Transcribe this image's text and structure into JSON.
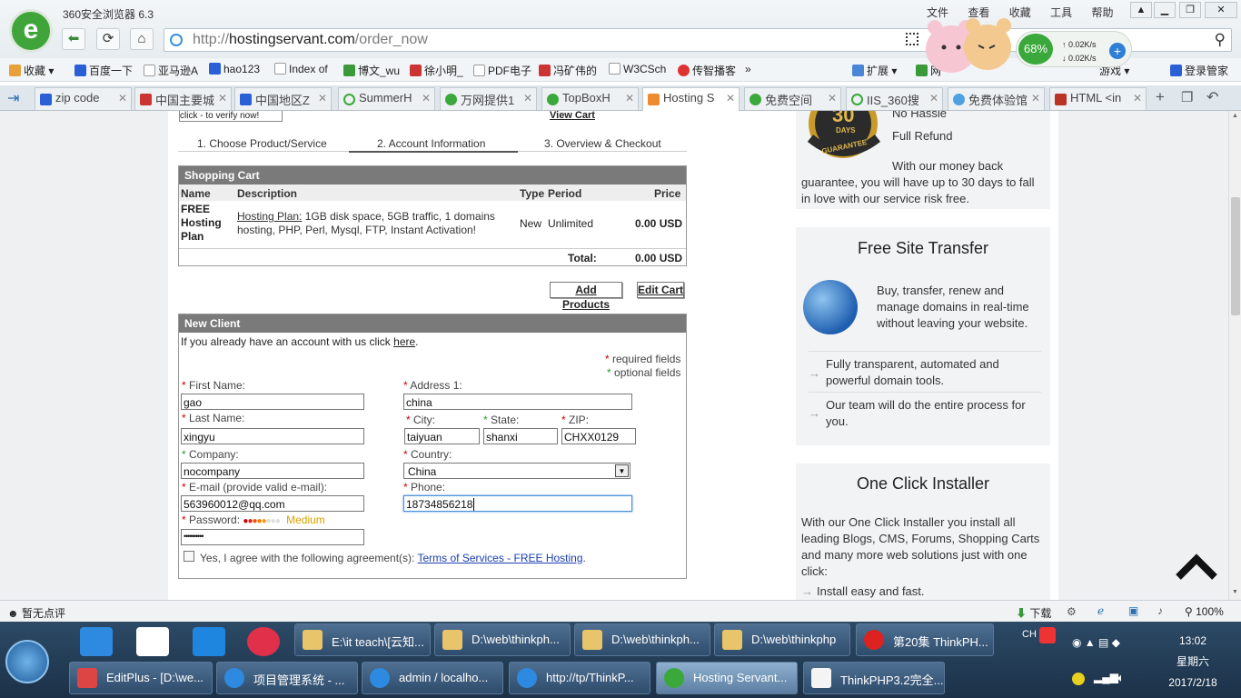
{
  "browser": {
    "app_title": "360安全浏览器 6.3",
    "url_prefix": "http://",
    "url_domain": "hostingservant.com",
    "url_path": "/order_now",
    "menu": [
      "文件",
      "查看",
      "收藏",
      "工具",
      "帮助"
    ],
    "speed_percent": "68%",
    "speed_up": "0.02K/s",
    "speed_down": "0.02K/s"
  },
  "bookmarks": [
    "收藏",
    "百度一下",
    "亚马逊A",
    "hao123",
    "Index of",
    "博文_wu",
    "徐小明_",
    "PDF电子",
    "冯矿伟的",
    "W3CSch",
    "传智播客",
    "扩展",
    "网",
    "登录管家"
  ],
  "bookmarks_extra": [
    "游戏"
  ],
  "tabs": [
    "zip code",
    "中国主要城",
    "中国地区Z",
    "SummerH",
    "万网提供1",
    "TopBoxH",
    "Hosting S",
    "免费空间",
    "IIS_360搜",
    "免费体验馆",
    "HTML <in"
  ],
  "order": {
    "top_button": "click - to verify now!",
    "top_link": "View Cart",
    "steps": [
      "1. Choose Product/Service",
      "2. Account Information",
      "3. Overview & Checkout"
    ],
    "cart": {
      "title": "Shopping Cart",
      "columns": [
        "Name",
        "Description",
        "Type",
        "Period",
        "Price"
      ],
      "item_name": "FREE Hosting Plan",
      "item_desc_link": "Hosting Plan:",
      "item_desc": "1GB disk space, 5GB traffic, 1 domains hosting, PHP, Perl, Mysql, FTP, Instant Activation!",
      "item_type": "New",
      "item_period": "Unlimited",
      "item_price": "0.00 USD",
      "total_label": "Total:",
      "total_value": "0.00 USD"
    },
    "buttons": {
      "add_products": "Add Products",
      "edit_cart": "Edit Cart"
    },
    "client": {
      "title": "New Client",
      "existing_text": "If you already have an account with us click",
      "existing_link": "here",
      "required_note": "required fields",
      "optional_note": "optional fields",
      "first_name_label": "First Name:",
      "first_name": "gao",
      "last_name_label": "Last Name:",
      "last_name": "xingyu",
      "company_label": "Company:",
      "company": "nocompany",
      "email_label": "E-mail (provide valid e-mail):",
      "email": "563960012@qq.com",
      "password_label": "Password:",
      "password": "••••••••••",
      "password_strength": "Medium",
      "address_label": "Address 1:",
      "address": "china",
      "city_label": "City:",
      "city": "taiyuan",
      "state_label": "State:",
      "state": "shanxi",
      "zip_label": "ZIP:",
      "zip": "CHXX0129",
      "country_label": "Country:",
      "country": "China",
      "phone_label": "Phone:",
      "phone": "18734856218",
      "agree_text": "Yes, I agree with the following agreement(s):",
      "agree_link": "Terms of Services - FREE Hosting"
    }
  },
  "sidebar": {
    "guarantee_days": "30",
    "guarantee_word": "DAYS",
    "guarantee_label": "GUARANTEE",
    "guarantee_line1": "No Hassle",
    "guarantee_line2": "Full Refund",
    "guarantee_text": "With our money back guarantee, you will have up to 30 days to fall in love with our service risk free.",
    "transfer_title": "Free Site Transfer",
    "transfer_text": "Buy, transfer, renew and manage domains in real-time without leaving your website.",
    "transfer_point1": "Fully transparent, automated and powerful domain tools.",
    "transfer_point2": "Our team will do the entire process for you.",
    "installer_title": "One Click Installer",
    "installer_text": "With our One Click Installer you install all leading Blogs, CMS, Forums, Shopping Carts and many more web solutions just with one click:",
    "installer_point1": "Install easy and fast."
  },
  "statusbar": {
    "left": "暂无点评",
    "download": "下载",
    "zoom": "100%"
  },
  "taskbar": {
    "tasks_top": [
      "E:\\it teach\\[云知...",
      "D:\\web\\thinkph...",
      "D:\\web\\thinkph...",
      "D:\\web\\thinkphp",
      "第20集 ThinkPH..."
    ],
    "tasks_bottom": [
      "EditPlus - [D:\\we...",
      "项目管理系统 - ...",
      "admin / localho...",
      "http://tp/ThinkP...",
      "Hosting Servant...",
      "ThinkPHP3.2完全..."
    ],
    "time": "13:02",
    "weekday": "星期六",
    "date": "2017/2/18",
    "lang": "CH"
  }
}
